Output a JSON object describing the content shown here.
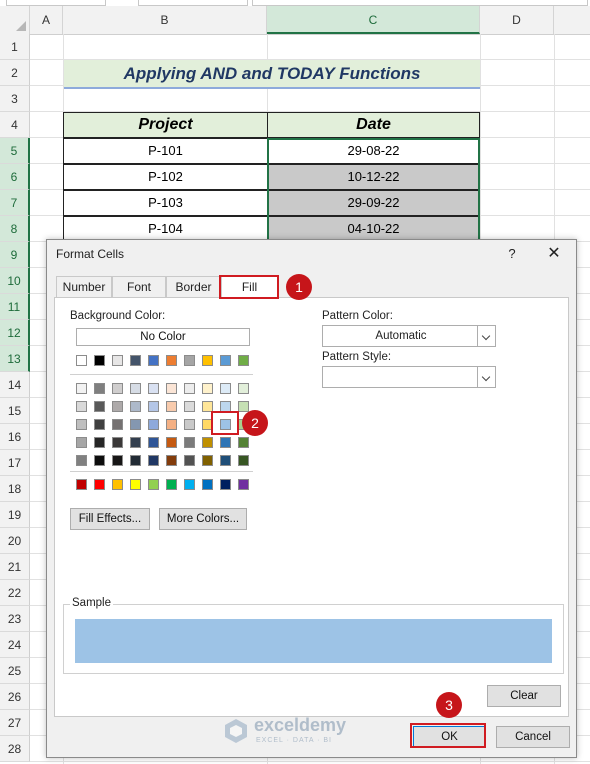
{
  "columns": [
    "A",
    "B",
    "C",
    "D"
  ],
  "rows": [
    "1",
    "2",
    "3",
    "4",
    "5",
    "6",
    "7",
    "8",
    "9",
    "10",
    "11",
    "12",
    "13",
    "14",
    "15",
    "16",
    "17",
    "18",
    "19",
    "20",
    "21",
    "22",
    "23",
    "24",
    "25",
    "26",
    "27",
    "28"
  ],
  "sheet": {
    "title": "Applying AND and TODAY Functions",
    "headers": [
      "Project",
      "Date"
    ],
    "data": [
      [
        "P-101",
        "29-08-22"
      ],
      [
        "P-102",
        "10-12-22"
      ],
      [
        "P-103",
        "29-09-22"
      ],
      [
        "P-104",
        "04-10-22"
      ]
    ]
  },
  "dialog": {
    "title": "Format Cells",
    "help": "?",
    "close": "✕",
    "tabs": [
      "Number",
      "Font",
      "Border",
      "Fill"
    ],
    "background_color_label": "Background Color:",
    "no_color": "No Color",
    "fill_effects": "Fill Effects...",
    "more_colors": "More Colors...",
    "pattern_color_label": "Pattern Color:",
    "pattern_color_value": "Automatic",
    "pattern_style_label": "Pattern Style:",
    "pattern_style_value": "",
    "sample_label": "Sample",
    "sample_color": "#9dc3e6",
    "clear": "Clear",
    "ok": "OK",
    "cancel": "Cancel"
  },
  "palette": {
    "theme_top": [
      "#ffffff",
      "#000000",
      "#e7e6e6",
      "#44546a",
      "#4472c4",
      "#ed7d31",
      "#a5a5a5",
      "#ffc000",
      "#5b9bd5",
      "#70ad47"
    ],
    "theme_shades": [
      [
        "#f2f2f2",
        "#7f7f7f",
        "#d0cece",
        "#d6dce5",
        "#d9e1f2",
        "#fbe5d6",
        "#ededed",
        "#fff2cc",
        "#ddebf7",
        "#e2efda"
      ],
      [
        "#d9d9d9",
        "#595959",
        "#aeaaaa",
        "#adb9ca",
        "#b4c6e7",
        "#f8cbad",
        "#dbdbdb",
        "#ffe699",
        "#bdd7ee",
        "#c6e0b4"
      ],
      [
        "#bfbfbf",
        "#404040",
        "#757171",
        "#8497b0",
        "#8ea9db",
        "#f4b084",
        "#c9c9c9",
        "#ffd966",
        "#9dc3e6",
        "#a9d08e"
      ],
      [
        "#a6a6a6",
        "#262626",
        "#3a3838",
        "#333f4f",
        "#2f5597",
        "#c55a11",
        "#7b7b7b",
        "#bf8f00",
        "#2e75b6",
        "#548235"
      ],
      [
        "#808080",
        "#0d0d0d",
        "#171616",
        "#222b35",
        "#203764",
        "#833c0c",
        "#525252",
        "#806000",
        "#1f4e78",
        "#375623"
      ]
    ],
    "standard": [
      "#c00000",
      "#ff0000",
      "#ffc000",
      "#ffff00",
      "#92d050",
      "#00b050",
      "#00b0f0",
      "#0070c0",
      "#002060",
      "#7030a0"
    ]
  },
  "callouts": [
    "1",
    "2",
    "3"
  ],
  "watermark": {
    "name": "exceldemy",
    "tagline": "EXCEL · DATA · BI"
  }
}
